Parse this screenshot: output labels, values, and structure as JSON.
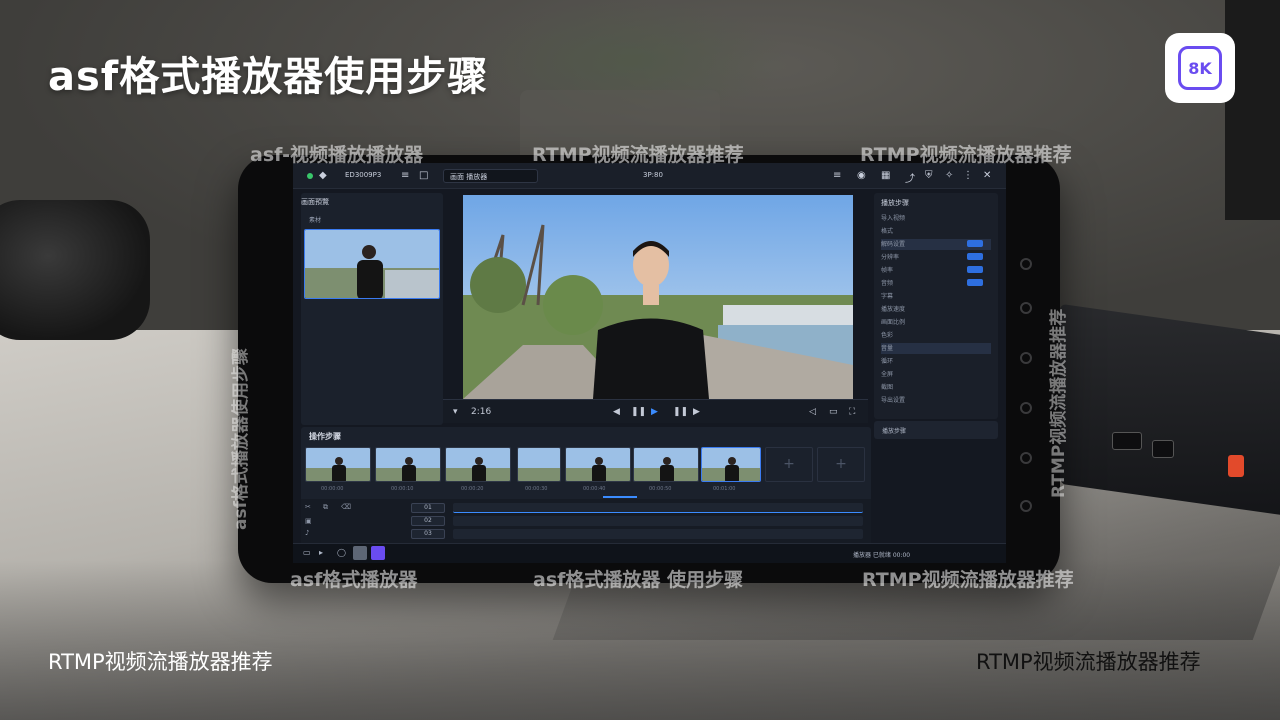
{
  "header": {
    "title": "asf格式播放器使用步骤",
    "logo_text": "8K"
  },
  "watermarks": {
    "top_left": "asf-视频播放播放器",
    "top_center": "RTMP视频流播放器推荐",
    "top_right": "RTMP视频流播放器推荐",
    "bottom_left": "asf格式播放器",
    "bottom_center": "asf格式播放器 使用步骤",
    "bottom_right": "RTMP视频流播放器推荐",
    "vertical_left": "asf格式播放器使用步骤",
    "vertical_right": "RTMP视频流播放器推荐"
  },
  "captions": {
    "bottom_left": "RTMP视频流播放器推荐",
    "bottom_right": "RTMP视频流播放器推荐"
  },
  "app": {
    "topbar": {
      "project_name": "ED3009P3",
      "field_text": "画面 播放器",
      "center_title": "3P:80"
    },
    "left_panel": {
      "title": "画面預覽",
      "tab": "素材"
    },
    "player": {
      "time": "2:16",
      "controls": [
        "prev",
        "pause",
        "play",
        "next-frame",
        "next"
      ]
    },
    "right_panel": {
      "title": "播放步骤",
      "rows": [
        {
          "label": "导入视频",
          "toggle": false
        },
        {
          "label": "格式",
          "toggle": false
        },
        {
          "label": "解码设置",
          "toggle": true,
          "highlighted": true
        },
        {
          "label": "分辨率",
          "toggle": true
        },
        {
          "label": "帧率",
          "toggle": true
        },
        {
          "label": "音频",
          "toggle": true
        },
        {
          "label": "字幕",
          "toggle": false
        },
        {
          "label": "播放速度",
          "toggle": false
        },
        {
          "label": "画面比例",
          "toggle": false
        },
        {
          "label": "色彩",
          "toggle": false
        },
        {
          "label": "音量",
          "toggle": false,
          "highlighted": true
        },
        {
          "label": "循环",
          "toggle": false
        },
        {
          "label": "全屏",
          "toggle": false
        },
        {
          "label": "截图",
          "toggle": false
        },
        {
          "label": "导出设置",
          "toggle": false
        }
      ],
      "bottom_label": "播放步骤"
    },
    "steps": {
      "title": "操作步骤",
      "labels": [
        "00:00:00",
        "00:00:10",
        "00:00:20",
        "00:00:30",
        "00:00:40",
        "00:00:50",
        "00:01:00"
      ]
    },
    "timeline": {
      "buttons": [
        "01",
        "02",
        "03"
      ]
    },
    "bottombar": {
      "status": "播放器 已就绪 00:00"
    }
  }
}
